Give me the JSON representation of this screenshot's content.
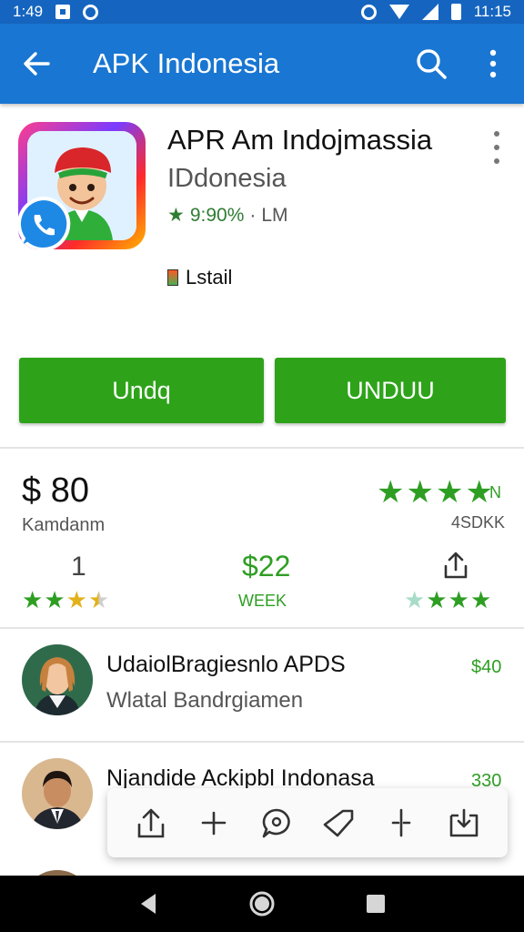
{
  "status_bar": {
    "time_left": "1:49",
    "time_right": "11:15"
  },
  "app_bar": {
    "title": "APK Indonesia",
    "icons": [
      "back-arrow-icon",
      "search-icon",
      "more-vert-icon"
    ]
  },
  "app": {
    "title": "APR Am Indojmassia",
    "subtitle": "IDdonesia",
    "rating_star": "★",
    "rating_text": "9:90%",
    "rating_sep": " · ",
    "rating_suffix": "LM",
    "install_label": "Lstail"
  },
  "buttons": {
    "left_label": "Undq",
    "right_label": "UNDUU"
  },
  "stats": {
    "price": "$ 80",
    "price_label": "Kamdanm",
    "right_stars_tail": "N",
    "right_label": "4SDKK",
    "col1_value": "1",
    "col2_value": "$22",
    "col2_label": "WEEK",
    "left_stars_rating": 3.5,
    "right_stars_rating": 4.5,
    "top_stars_rating": 5
  },
  "list": [
    {
      "title": "UdaiolBragiesnlo APDS",
      "subtitle": "Wlatal Bandrgiamen",
      "value": "$40"
    },
    {
      "title": "Njandide Ackipbl Indonasa",
      "subtitle": "",
      "value": "330"
    },
    {
      "title": "",
      "subtitle": "",
      "value": ""
    }
  ],
  "toolbar": {
    "icons": [
      "upload-icon",
      "add-icon",
      "chat-icon",
      "tag-icon",
      "split-icon",
      "download-icon"
    ]
  },
  "nav_bar": {
    "icons": [
      "back-nav-icon",
      "home-nav-icon",
      "recents-nav-icon"
    ]
  },
  "colors": {
    "primary": "#1976d2",
    "status_bar": "#1565c0",
    "accent_green": "#2ea31a",
    "text_green": "#2e9e23"
  }
}
